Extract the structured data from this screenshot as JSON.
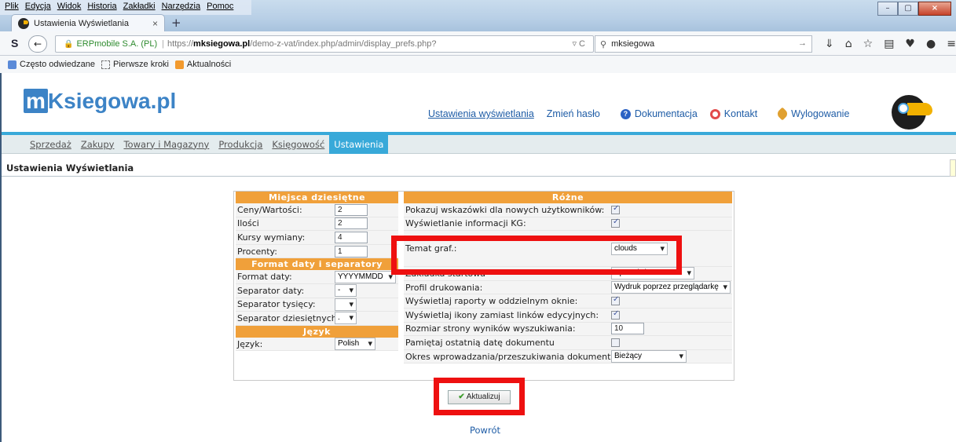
{
  "browser": {
    "menu": [
      "Plik",
      "Edycja",
      "Widok",
      "Historia",
      "Zakładki",
      "Narzędzia",
      "Pomoc"
    ],
    "tab_title": "Ustawienia Wyświetlania",
    "tab_close": "×",
    "new_tab": "+",
    "site_identity": "ERPmobile S.A. (PL)",
    "url_prefix": "https://",
    "url_host": "mksiegowa.pl",
    "url_path": "/demo-z-vat/index.php/admin/display_prefs.php?",
    "url_right": "▿ C",
    "search_value": "mksiegowa",
    "bookmarks": [
      "Często odwiedzane",
      "Pierwsze kroki",
      "Aktualności"
    ]
  },
  "header": {
    "logo_m": "m",
    "logo_rest": "Ksiegowa.pl",
    "links": {
      "display_settings": "Ustawienia wyświetlania",
      "change_password": "Zmień hasło",
      "documentation": "Dokumentacja",
      "contact": "Kontakt",
      "logout": "Wylogowanie"
    }
  },
  "nav": [
    "Sprzedaż",
    "Zakupy",
    "Towary i Magazyny",
    "Produkcja",
    "Księgowość",
    "Ustawienia"
  ],
  "page_title": "Ustawienia Wyświetlania",
  "left_panel": {
    "decimals_header": "Miejsca dziesiętne",
    "prices_label": "Ceny/Wartości:",
    "prices_value": "2",
    "qty_label": "Ilości",
    "qty_value": "2",
    "rates_label": "Kursy wymiany:",
    "rates_value": "4",
    "percent_label": "Procenty:",
    "percent_value": "1",
    "date_header": "Format daty i separatory",
    "date_format_label": "Format daty:",
    "date_format_value": "YYYYMMDD",
    "date_sep_label": "Separator daty:",
    "date_sep_value": "-",
    "thousand_sep_label": "Separator tysięcy:",
    "thousand_sep_value": "",
    "decimal_sep_label": "Separator dziesiętnych:",
    "decimal_sep_value": ".",
    "language_header": "Język",
    "language_label": "Język:",
    "language_value": "Polish"
  },
  "right_panel": {
    "header": "Różne",
    "hints_label": "Pokazuj wskazówki dla nowych użytkowników:",
    "hints_checked": true,
    "kg_label": "Wyświetlanie informacji KG:",
    "kg_checked": true,
    "theme_label": "Temat graf.:",
    "theme_value": "clouds",
    "start_tab_label": "Zakładka startowa",
    "start_tab_value": "Sprzedaż",
    "print_profile_label": "Profil drukowania:",
    "print_profile_value": "Wydruk poprzez przeglądarkę",
    "reports_label": "Wyświetlaj raporty w oddzielnym oknie:",
    "reports_checked": true,
    "icons_label": "Wyświetlaj ikony zamiast linków edycyjnych:",
    "icons_checked": true,
    "page_size_label": "Rozmiar strony wyników wyszukiwania:",
    "page_size_value": "10",
    "remember_date_label": "Pamiętaj ostatnią datę dokumentu",
    "remember_date_checked": false,
    "period_label": "Okres wprowadzania/przeszukiwania dokumentów:",
    "period_value": "Bieżący"
  },
  "update_button": "Aktualizuj",
  "back_link": "Powrót",
  "colors": {
    "accent": "#38a9d9",
    "panel_header": "#f0a03a",
    "highlight": "#ee1010",
    "link": "#1e5ca6"
  }
}
